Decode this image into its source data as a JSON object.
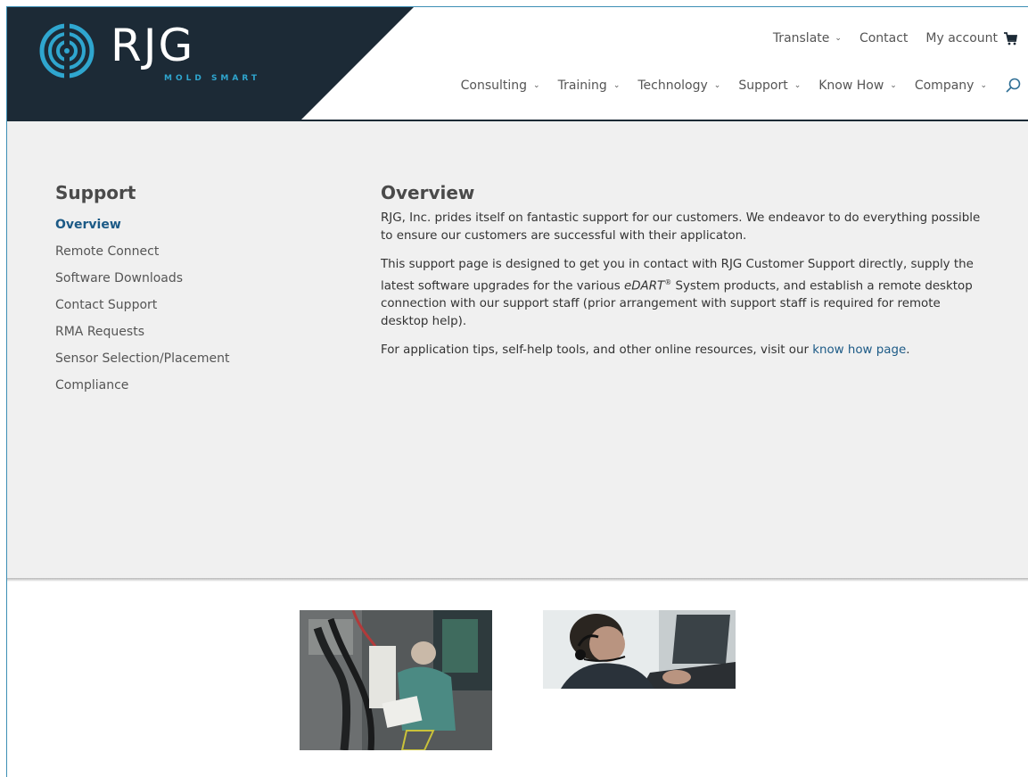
{
  "brand": {
    "name": "RJG",
    "tagline": "MOLD SMART",
    "dark_color": "#1c2a36",
    "accent_color": "#2fa6cf",
    "link_color": "#1c5a86"
  },
  "utility_nav": {
    "translate": "Translate",
    "contact": "Contact",
    "account": "My account"
  },
  "main_nav": {
    "items": [
      {
        "label": "Consulting"
      },
      {
        "label": "Training"
      },
      {
        "label": "Technology"
      },
      {
        "label": "Support"
      },
      {
        "label": "Know How"
      },
      {
        "label": "Company"
      }
    ]
  },
  "sidebar": {
    "title": "Support",
    "items": [
      {
        "label": "Overview",
        "active": true
      },
      {
        "label": "Remote Connect"
      },
      {
        "label": "Software Downloads"
      },
      {
        "label": "Contact Support"
      },
      {
        "label": "RMA Requests"
      },
      {
        "label": "Sensor Selection/Placement"
      },
      {
        "label": "Compliance"
      }
    ]
  },
  "article": {
    "title": "Overview",
    "p1": "RJG, Inc. prides itself on fantastic support for our customers. We endeavor to do everything possible to ensure our customers are successful with their applicaton.",
    "p2_before": "This support page is designed to get you in contact with RJG Customer Support directly, supply the latest software upgrades for the various ",
    "p2_product": "eDART",
    "p2_reg": "®",
    "p2_after": " System products, and establish a remote desktop connection with our support staff (prior arrangement with support staff is required for remote desktop help).",
    "p3_before": "For application tips, self-help tools, and other online resources, visit our ",
    "p3_link": "know how page",
    "p3_after": "."
  }
}
